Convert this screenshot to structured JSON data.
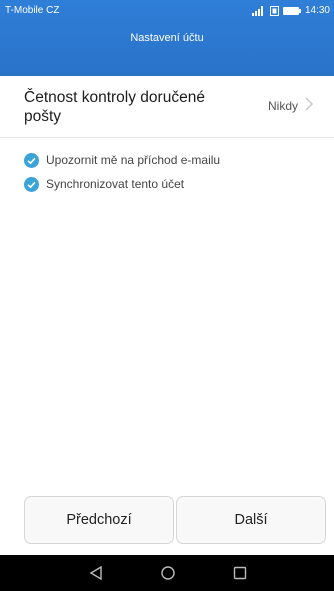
{
  "status_bar": {
    "carrier": "T-Mobile CZ",
    "time": "14:30",
    "icons": [
      "signal-icon",
      "data-icon",
      "battery-icon"
    ]
  },
  "header": {
    "title": "Nastavení účtu"
  },
  "settings": {
    "check_frequency": {
      "label": "Četnost kontroly doručené pošty",
      "value": "Nikdy"
    },
    "options": [
      {
        "label": "Upozornit mě na příchod e-mailu",
        "checked": true
      },
      {
        "label": "Synchronizovat tento účet",
        "checked": true
      }
    ]
  },
  "buttons": {
    "previous": "Předchozí",
    "next": "Další"
  },
  "navigation": [
    "back-icon",
    "home-icon",
    "recents-icon"
  ],
  "colors": {
    "accent": "#2f7ed8",
    "check": "#3aa4d8"
  }
}
